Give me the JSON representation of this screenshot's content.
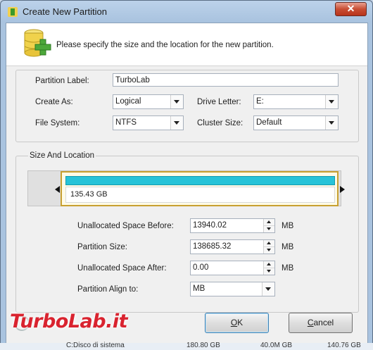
{
  "window": {
    "title": "Create New Partition",
    "close_glyph": "✕"
  },
  "header": {
    "text": "Please specify the size and the location for the new partition."
  },
  "form": {
    "partition_label": {
      "label": "Partition Label:",
      "value": "TurboLab"
    },
    "create_as": {
      "label": "Create As:",
      "value": "Logical"
    },
    "drive_letter": {
      "label": "Drive Letter:",
      "value": "E:"
    },
    "file_system": {
      "label": "File System:",
      "value": "NTFS"
    },
    "cluster_size": {
      "label": "Cluster Size:",
      "value": "Default"
    }
  },
  "size_location": {
    "group_title": "Size And Location",
    "partition_size_display": "135.43 GB",
    "partition_fill_fraction": 1.0,
    "unallocated_before": {
      "label": "Unallocated Space Before:",
      "value": "13940.02",
      "unit": "MB"
    },
    "partition_size": {
      "label": "Partition Size:",
      "value": "138685.32",
      "unit": "MB"
    },
    "unallocated_after": {
      "label": "Unallocated Space After:",
      "value": "0.00",
      "unit": "MB"
    },
    "align_to": {
      "label": "Partition Align to:",
      "value": "MB"
    }
  },
  "buttons": {
    "ok": {
      "mnemonic": "O",
      "rest": "K"
    },
    "cancel": {
      "mnemonic": "C",
      "rest": "ancel"
    }
  },
  "background_row": {
    "name": "C:Disco di sistema",
    "size": "180.80 GB",
    "used": "40.0M GB",
    "free": "140.76 GB"
  },
  "watermark": {
    "text": "TurboLab.it"
  },
  "colors": {
    "partition_fill": "#27c3d8",
    "partition_border": "#c8a030",
    "close_button": "#c84d33",
    "watermark": "#d9232f"
  }
}
